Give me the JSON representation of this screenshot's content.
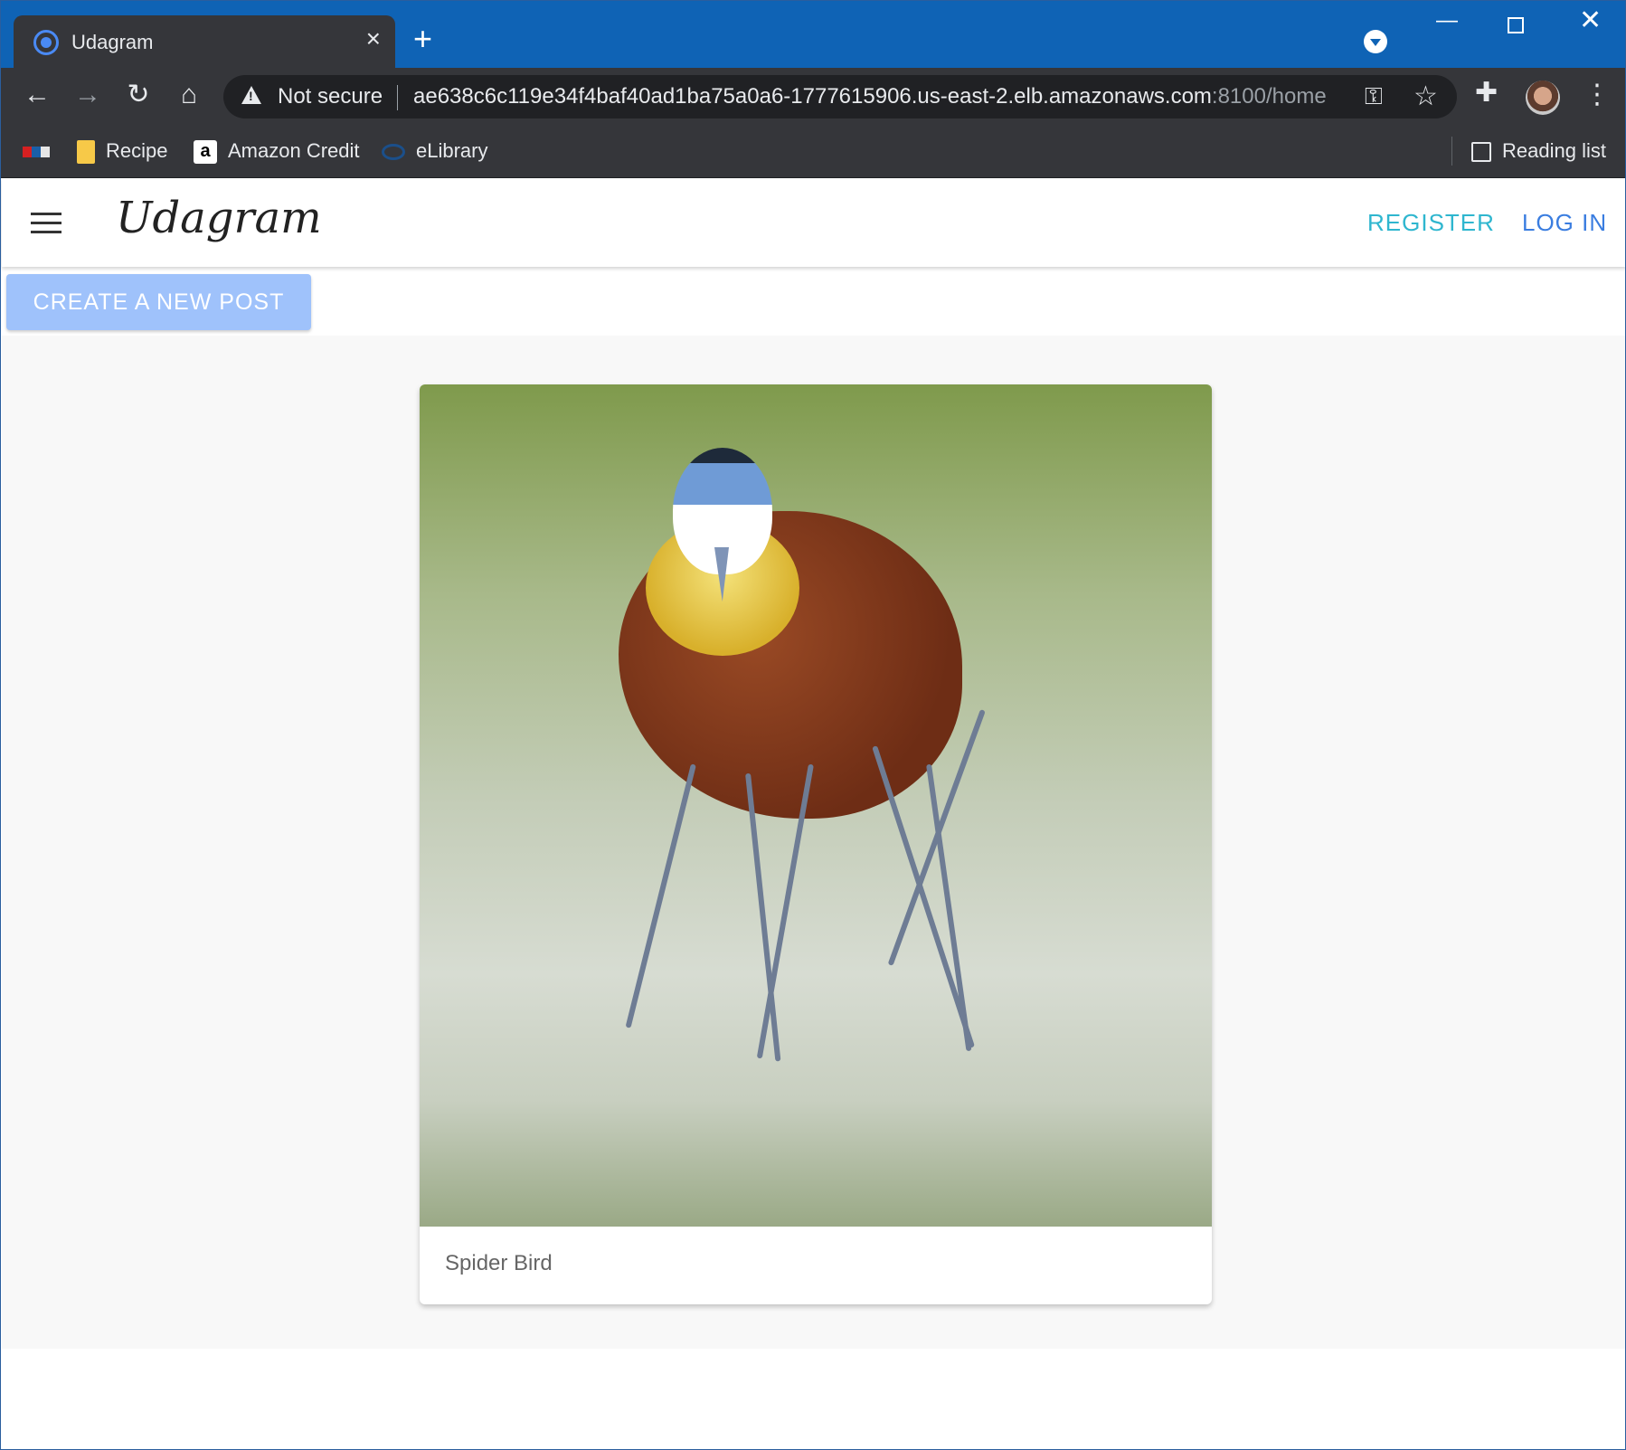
{
  "browser": {
    "tab_title": "Udagram",
    "tab_close": "×",
    "new_tab": "+",
    "window": {
      "minimize": "—",
      "close": "✕"
    },
    "nav": {
      "back": "←",
      "forward": "→",
      "reload": "↻",
      "home": "⌂"
    },
    "omnibox": {
      "security_label": "Not secure",
      "url_host": "ae638c6c119e34f4baf40ad1ba75a0a6-1777615906.us-east-2.elb.amazonaws.com",
      "url_rest": ":8100/home"
    },
    "icons": {
      "key": "key-icon",
      "star": "☆",
      "extensions": "puzzle-icon",
      "menu": "⋮"
    },
    "bookmarks": [
      {
        "label": "",
        "icon": "npr-icon"
      },
      {
        "label": "Recipe",
        "icon": "folder-icon"
      },
      {
        "label": "Amazon Credit",
        "icon": "amazon-icon",
        "glyph": "a"
      },
      {
        "label": "eLibrary",
        "icon": "elibrary-icon"
      }
    ],
    "reading_list": "Reading list"
  },
  "app": {
    "logo": "Udagram",
    "register": "REGISTER",
    "login": "LOG IN",
    "create_post": "CREATE A NEW POST",
    "feed": [
      {
        "caption": "Spider Bird"
      }
    ]
  },
  "colors": {
    "titlebar": "#0f63b5",
    "register": "#2fb6cf",
    "login": "#3a7de0",
    "create_button": "#9fc2fb"
  }
}
